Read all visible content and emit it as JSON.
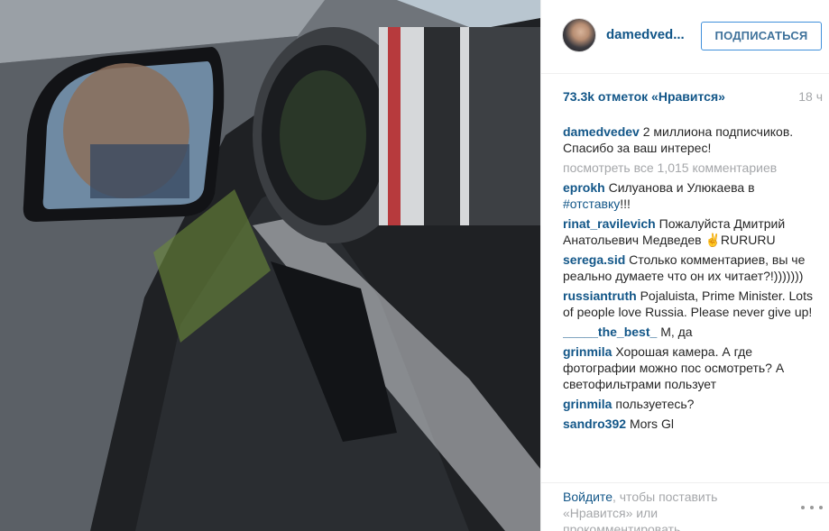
{
  "post": {
    "header": {
      "username": "damedved...",
      "follow_label": "ПОДПИСАТЬСЯ"
    },
    "likes": "73.3k отметок «Нравится»",
    "time": "18 ч",
    "caption": {
      "user": "damedvedev",
      "text": "2 миллиона подписчиков. Спасибо за ваш интерес!"
    },
    "view_all": "посмотреть все 1,015 комментариев",
    "comments": [
      {
        "user": "eprokh",
        "text": "Силуанова и Улюкаева в ",
        "tag": "#отставку",
        "tail": "!!!"
      },
      {
        "user": "rinat_ravilevich",
        "text": "Пожалуйста Дмитрий Анатольевич Медведев ✌RURURU",
        "tag": "",
        "tail": ""
      },
      {
        "user": "serega.sid",
        "text": "Столько комментариев, вы че реально думаете что он их читает?!)))))))",
        "tag": "",
        "tail": ""
      },
      {
        "user": "russiantruth",
        "text": "Pojaluista, Prime Minister. Lots of people love Russia. Please never give up!",
        "tag": "",
        "tail": ""
      },
      {
        "user": "_____the_best_",
        "text": "М, да",
        "tag": "",
        "tail": ""
      },
      {
        "user": "grinmila",
        "text": "Хорошая камера. А где фотографии можно пос осмотреть? А светофильтрами пользует",
        "tag": "",
        "tail": ""
      },
      {
        "user": "grinmila",
        "text": "пользуетесь?",
        "tag": "",
        "tail": ""
      },
      {
        "user": "sandro392",
        "text": "Mors Gl",
        "tag": "",
        "tail": ""
      }
    ],
    "footer": {
      "login_link": "Войдите",
      "rest": ", чтобы поставить «Нравится» или прокомментировать."
    },
    "more_icon": "more-horizontal-icon"
  }
}
